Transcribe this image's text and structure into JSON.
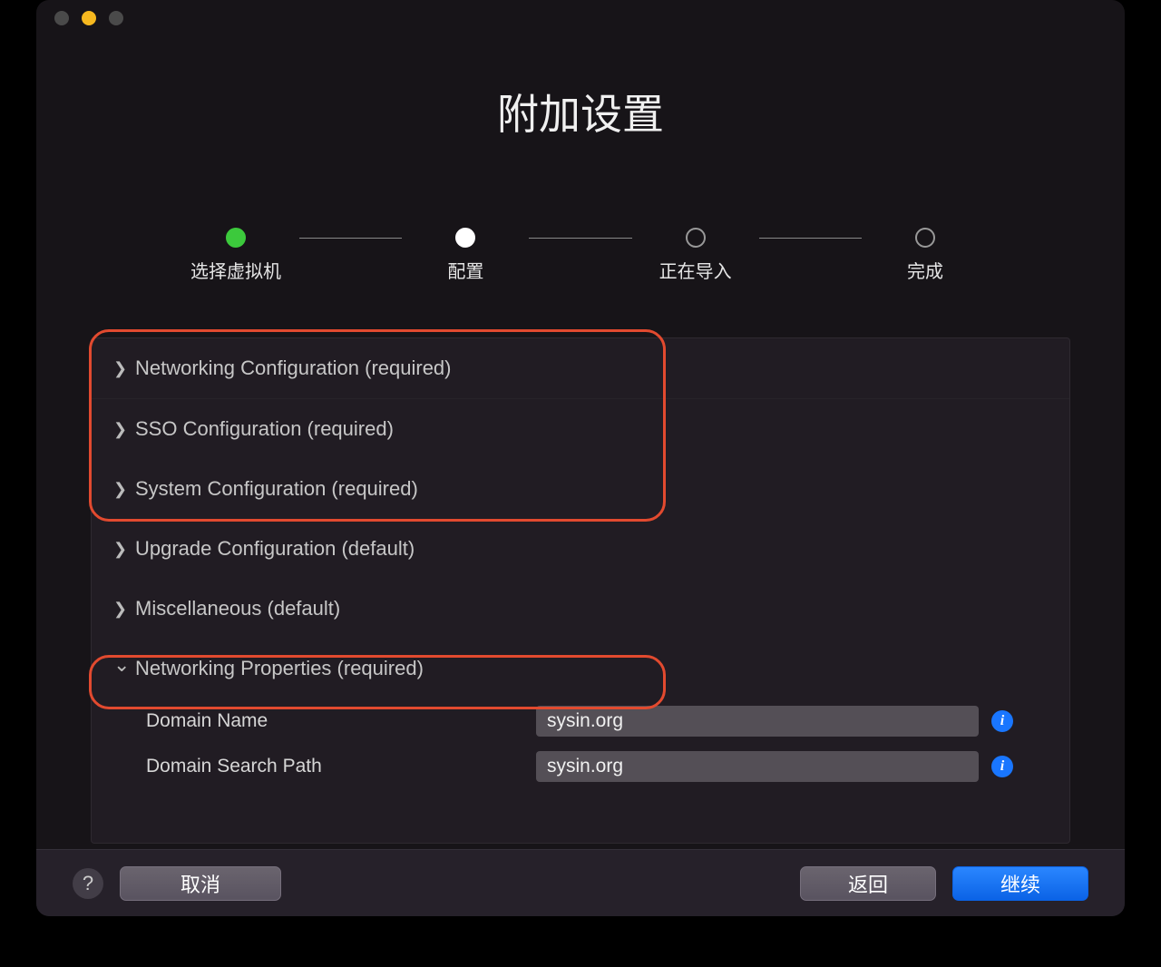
{
  "title": "附加设置",
  "stepper": [
    {
      "label": "选择虚拟机",
      "state": "done"
    },
    {
      "label": "配置",
      "state": "active"
    },
    {
      "label": "正在导入",
      "state": "pending"
    },
    {
      "label": "完成",
      "state": "pending"
    }
  ],
  "sections": {
    "networking_config": "Networking Configuration (required)",
    "sso_config": "SSO Configuration (required)",
    "system_config": "System Configuration (required)",
    "upgrade_config": "Upgrade Configuration (default)",
    "miscellaneous": "Miscellaneous (default)",
    "networking_props": "Networking Properties (required)"
  },
  "form": {
    "domain_name_label": "Domain Name",
    "domain_name_value": "sysin.org",
    "domain_search_label": "Domain Search Path",
    "domain_search_value": "sysin.org"
  },
  "footer": {
    "help": "?",
    "cancel": "取消",
    "back": "返回",
    "continue": "继续"
  },
  "info_glyph": "i"
}
